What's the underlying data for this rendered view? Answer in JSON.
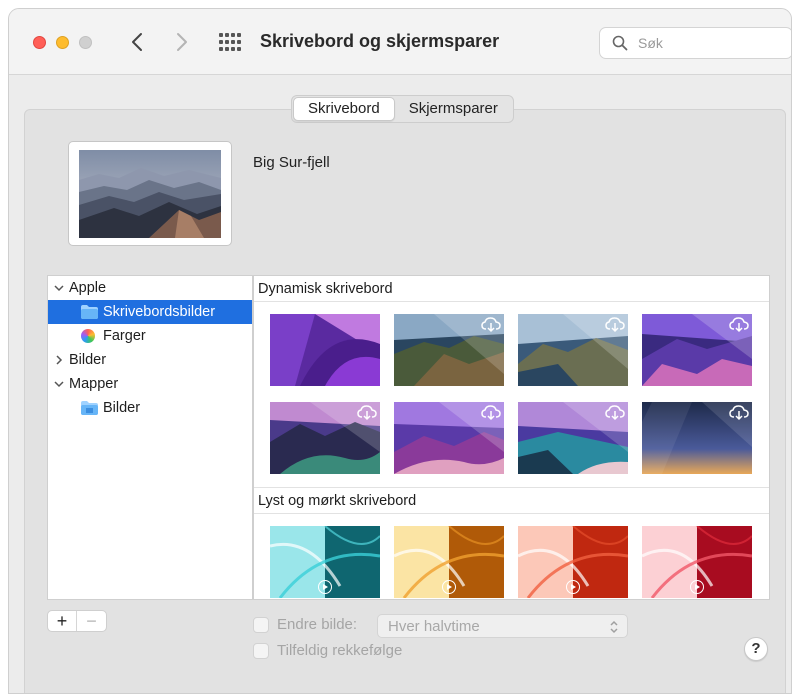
{
  "window": {
    "title": "Skrivebord og skjermsparer",
    "search_placeholder": "Søk"
  },
  "tabs": [
    {
      "label": "Skrivebord",
      "active": true
    },
    {
      "label": "Skjermsparer",
      "active": false
    }
  ],
  "current_wallpaper": {
    "name": "Big Sur-fjell"
  },
  "sidebar": {
    "items": [
      {
        "label": "Apple",
        "type": "group",
        "expanded": true
      },
      {
        "label": "Skrivebordsbilder",
        "type": "folder",
        "selected": true
      },
      {
        "label": "Farger",
        "type": "colors"
      },
      {
        "label": "Bilder",
        "type": "group",
        "expanded": false
      },
      {
        "label": "Mapper",
        "type": "group",
        "expanded": true
      },
      {
        "label": "Bilder",
        "type": "folder"
      }
    ]
  },
  "gallery": {
    "sections": [
      {
        "title": "Dynamisk skrivebord"
      },
      {
        "title": "Lyst og mørkt skrivebord"
      }
    ]
  },
  "controls": {
    "add_label": "+",
    "remove_label": "−",
    "change_picture_label": "Endre bilde:",
    "interval_value": "Hver halvtime",
    "random_order_label": "Tilfeldig rekkefølge",
    "help_label": "?"
  },
  "colors": {
    "selection": "#1f6fe0",
    "close": "#ff5f57",
    "minimize": "#febc2e"
  }
}
